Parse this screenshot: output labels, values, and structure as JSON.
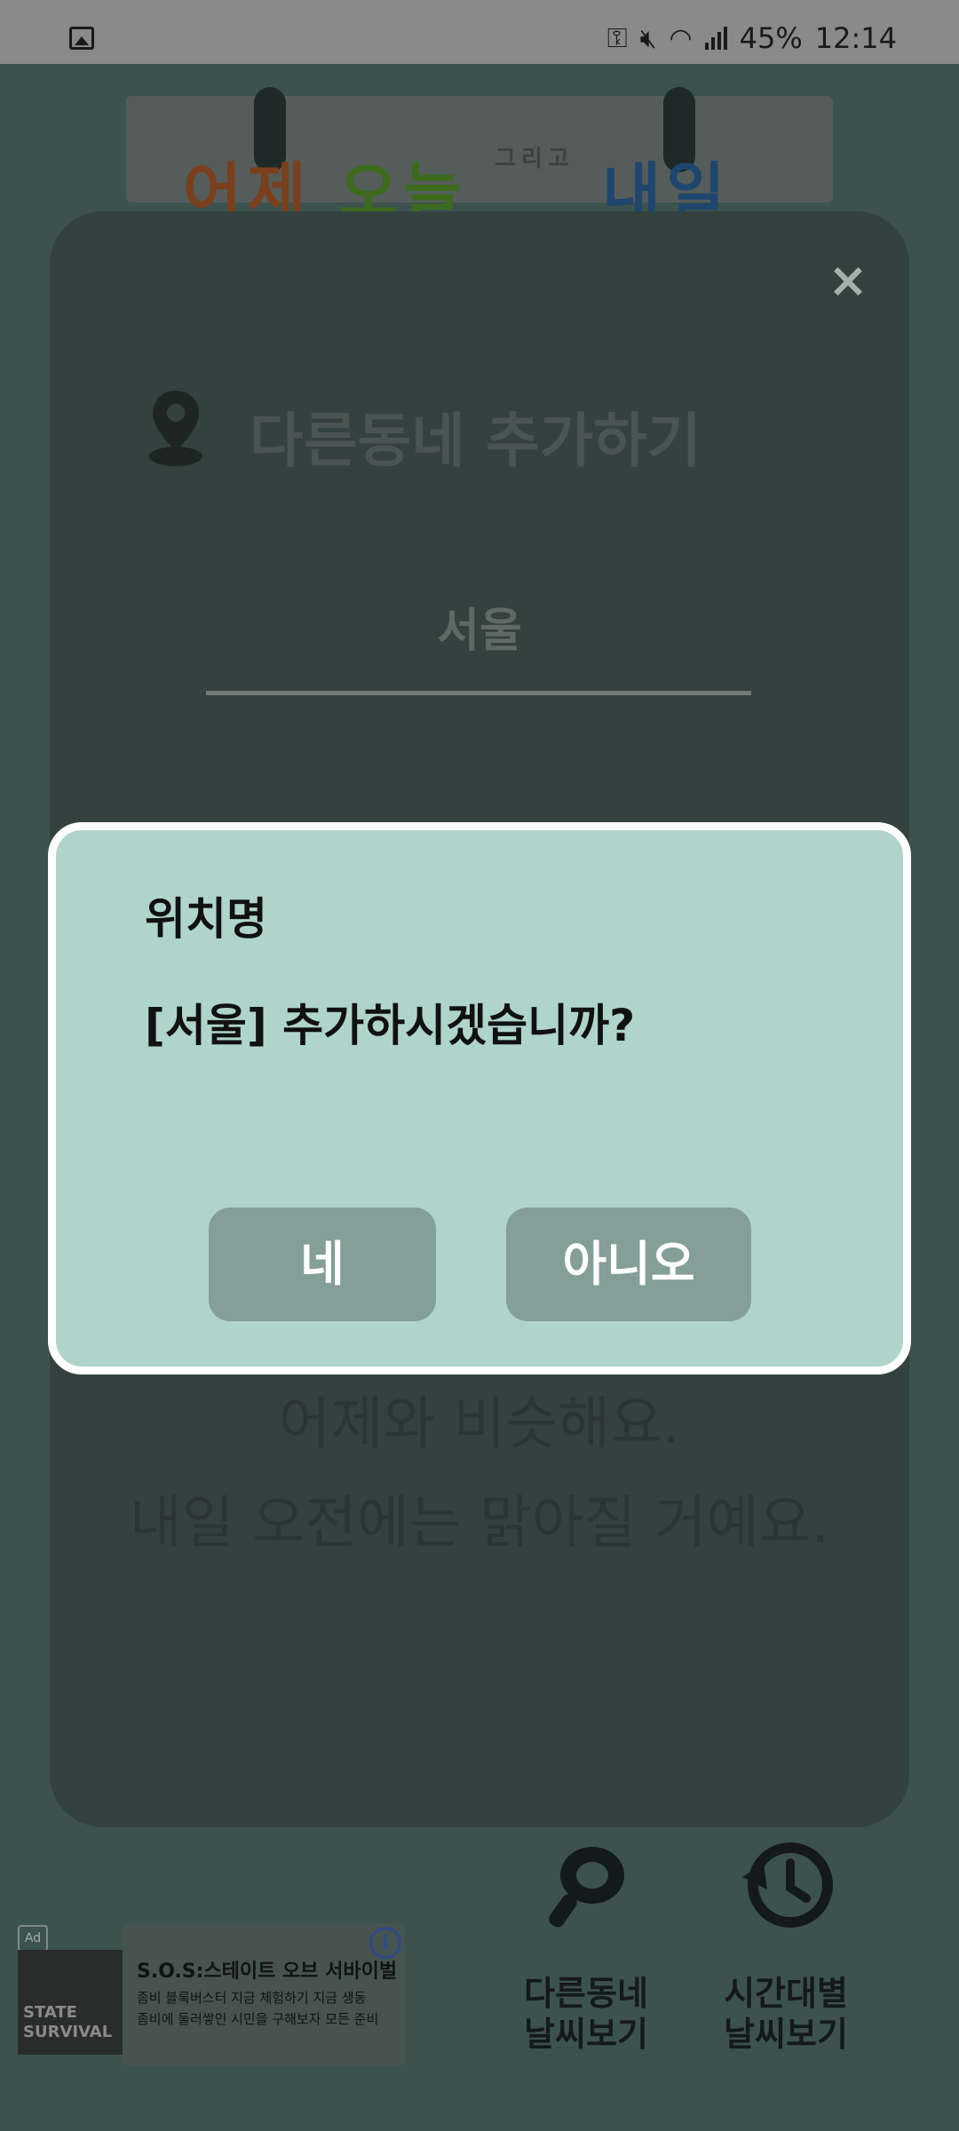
{
  "status_bar": {
    "battery": "45%",
    "time": "12:14",
    "icons": [
      "image-notification-icon",
      "vpn-key-icon",
      "mute-icon",
      "wifi-icon",
      "signal-icon"
    ]
  },
  "app": {
    "header_logo": {
      "part1": "어제",
      "part2": "오늘",
      "part3": "그리고",
      "part4": "내일"
    },
    "card": {
      "close_label": "×",
      "title": "다른동네 추가하기",
      "location_value": "서울",
      "forecast_line1": "어제와 비슷해요.",
      "forecast_line2": "내일 오전에는 맑아질 거예요."
    },
    "bottom_nav": {
      "other_area": "다른동네\n날씨보기",
      "hourly": "시간대별\n날씨보기"
    },
    "ad": {
      "badge": "Ad",
      "thumb_text": "STATE\nSURVIVAL",
      "title": "S.O.S:스테이트 오브 서바이벌",
      "desc_line1": "좀비 블록버스터 지금 체험하기 지금 생동",
      "desc_line2": "좀비에 둘러쌓인 시민을 구해보자 모든 준비",
      "info": "i"
    }
  },
  "dialog": {
    "title": "위치명",
    "message": "[서울] 추가하시겠습니까?",
    "yes_label": "네",
    "no_label": "아니오"
  },
  "colors": {
    "dialog_bg": "#afd4cb",
    "dialog_button": "#849e98",
    "overlay_bg": "#3a4d49",
    "status_bar": "#8a8a8a"
  }
}
